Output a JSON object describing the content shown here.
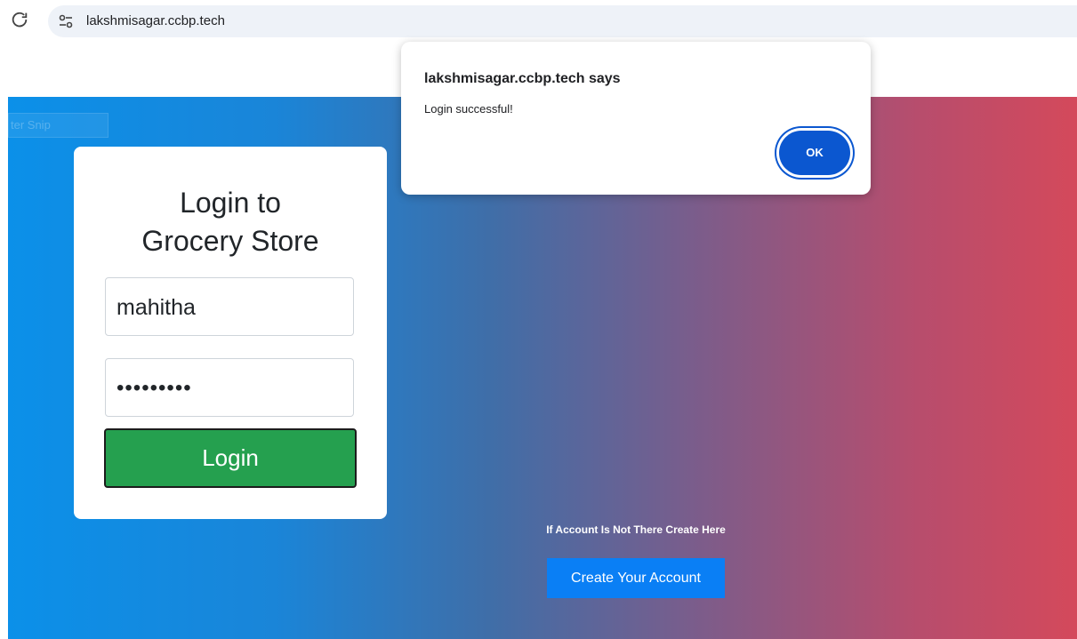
{
  "browser": {
    "url": "lakshmisagar.ccbp.tech",
    "reload_icon": "reload-icon",
    "site_info_icon": "tune-icon"
  },
  "background_box": {
    "text": "ter Snip"
  },
  "login_card": {
    "title_line1": "Login to",
    "title_line2": "Grocery Store",
    "username_value": "mahitha",
    "password_value": "•••••••••",
    "login_label": "Login"
  },
  "signup": {
    "prompt": "If Account Is Not There Create Here",
    "button_label": "Create Your Account"
  },
  "alert": {
    "title": "lakshmisagar.ccbp.tech says",
    "message": "Login successful!",
    "ok_label": "OK"
  },
  "colors": {
    "login_button": "#25a04f",
    "create_account_button": "#0a7ff5",
    "alert_ok": "#0b57d0",
    "gradient_start": "#0b90e9",
    "gradient_end": "#d4495b"
  }
}
